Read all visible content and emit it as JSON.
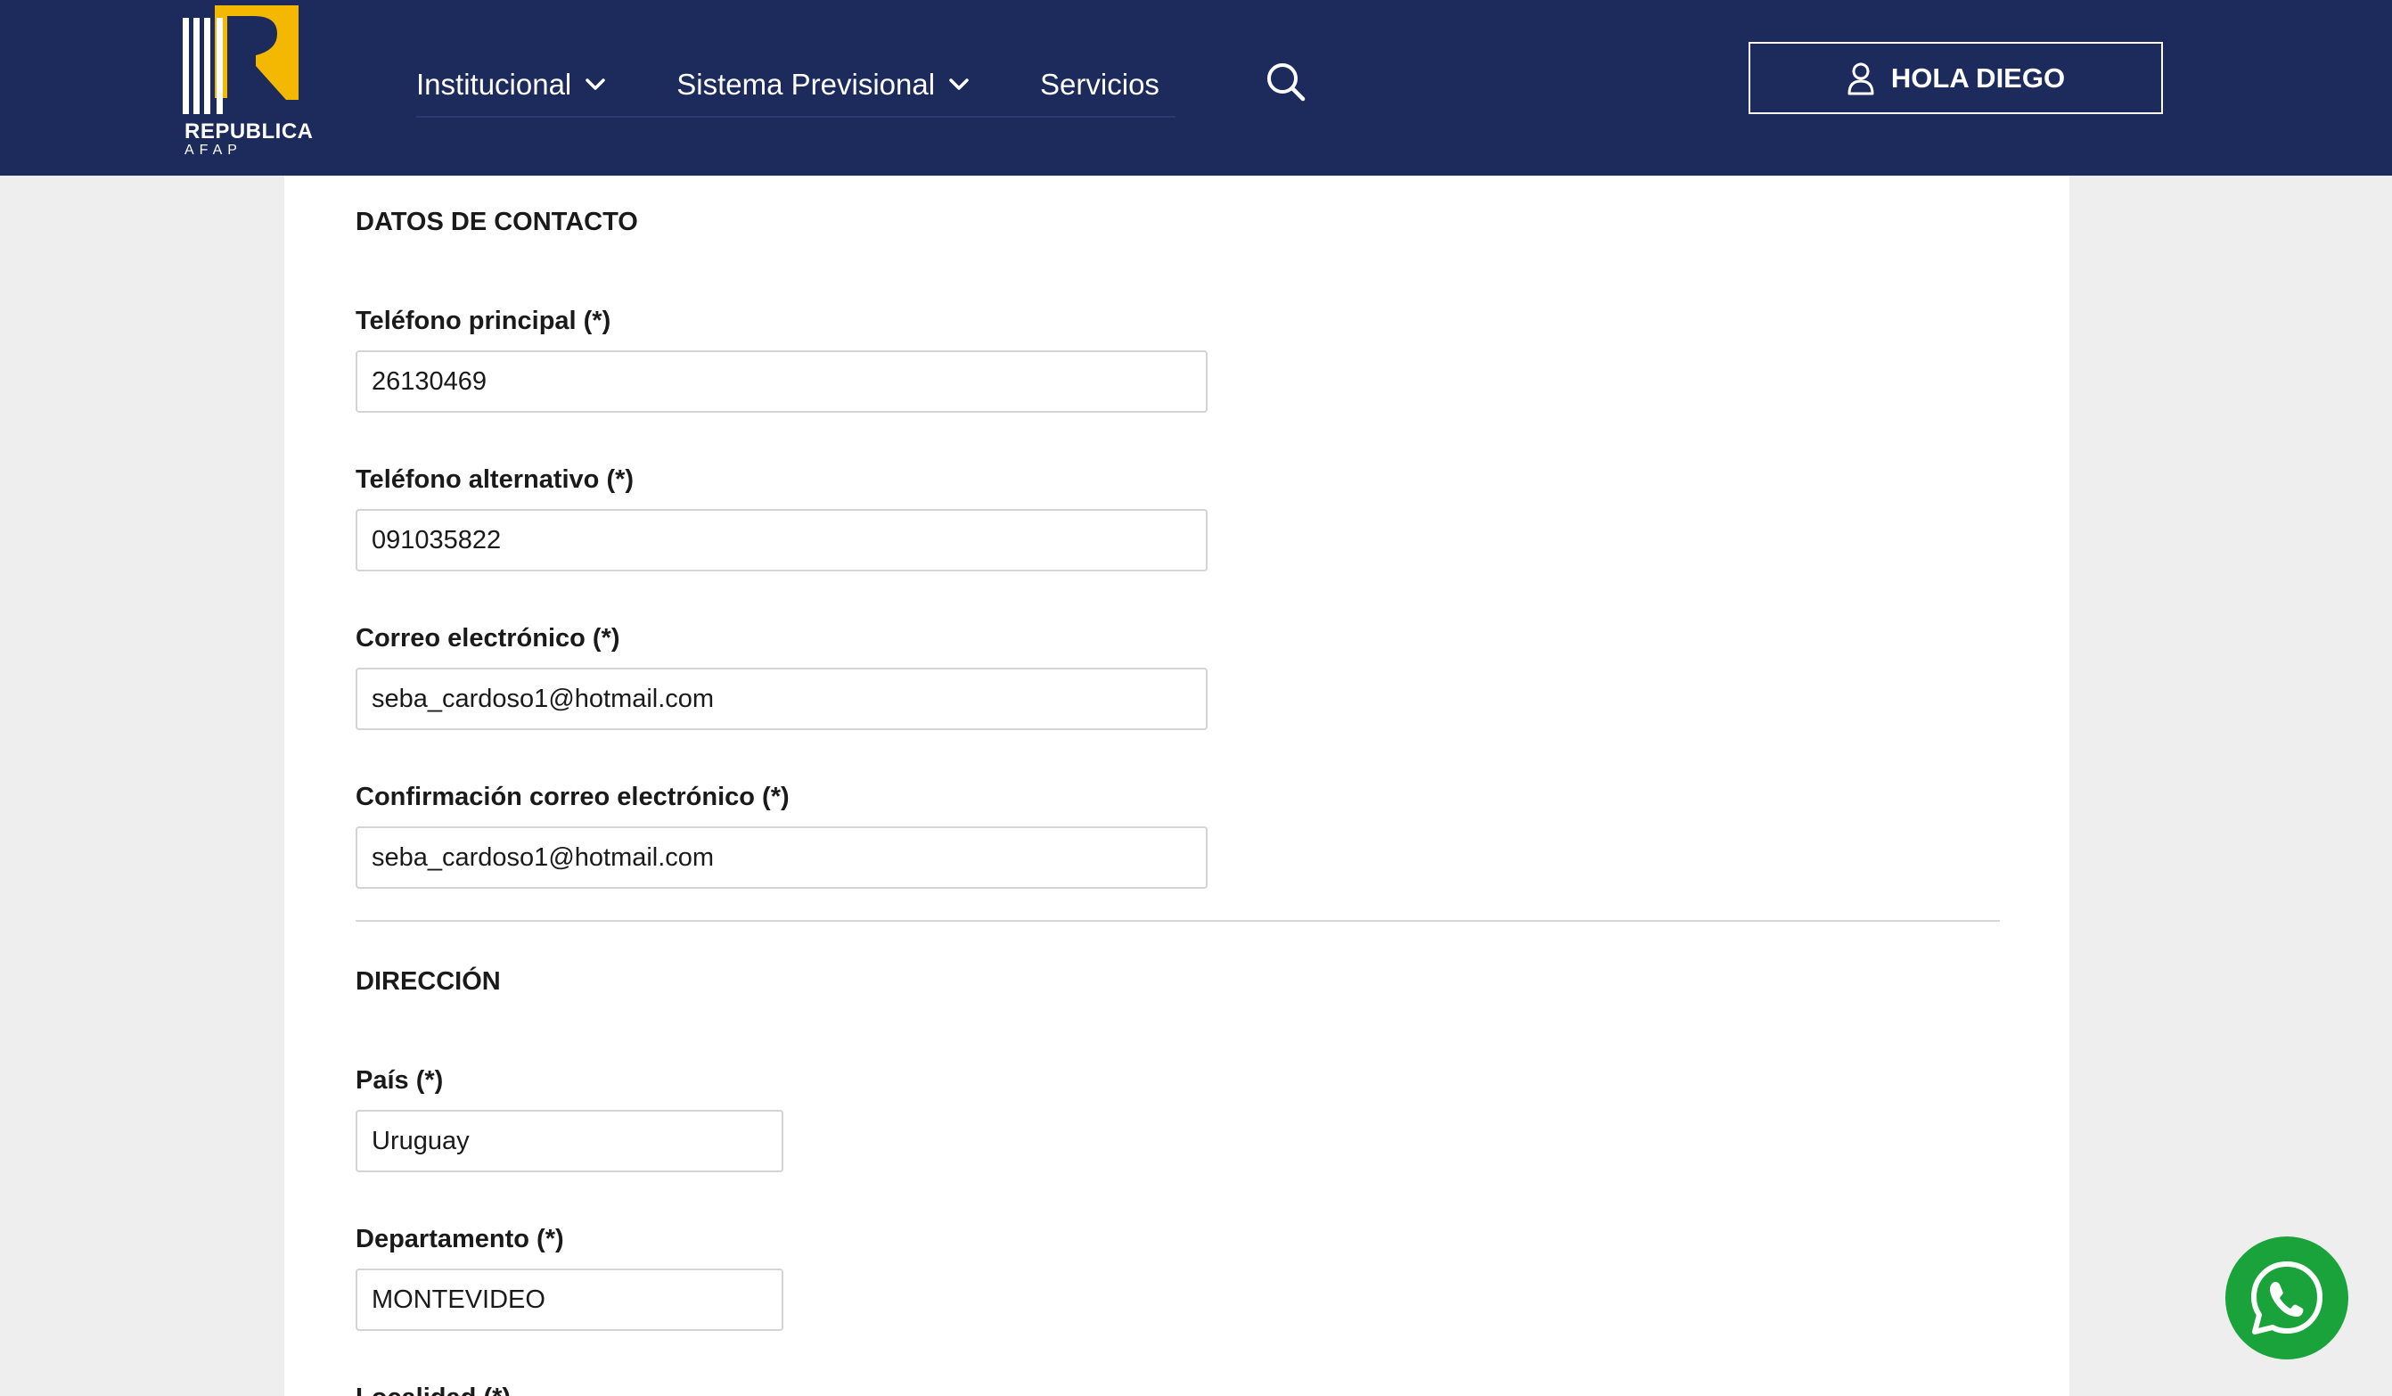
{
  "brand": {
    "name": "REPUBLICA",
    "sub": "AFAP",
    "colors": {
      "navy": "#1c2a5c",
      "gold": "#f5b800",
      "white": "#ffffff",
      "whatsapp": "#1aa33b"
    }
  },
  "nav": {
    "items": [
      {
        "label": "Institucional",
        "icon": "chevron-down-icon"
      },
      {
        "label": "Sistema Previsional",
        "icon": "chevron-down-icon"
      },
      {
        "label": "Servicios"
      }
    ],
    "search_icon": "search-icon"
  },
  "user": {
    "label": "HOLA DIEGO",
    "icon": "user-icon"
  },
  "contact": {
    "title": "DATOS DE CONTACTO",
    "phone_main": {
      "label": "Teléfono principal (*)",
      "value": "26130469"
    },
    "phone_alt": {
      "label": "Teléfono alternativo (*)",
      "value": "091035822"
    },
    "email": {
      "label": "Correo electrónico (*)",
      "value": "seba_cardoso1@hotmail.com"
    },
    "email_confirm": {
      "label": "Confirmación correo electrónico (*)",
      "value": "seba_cardoso1@hotmail.com"
    }
  },
  "address": {
    "title": "DIRECCIÓN",
    "country": {
      "label": "País (*)",
      "value": "Uruguay"
    },
    "department": {
      "label": "Departamento (*)",
      "value": "MONTEVIDEO"
    },
    "locality": {
      "label": "Localidad (*)"
    }
  },
  "whatsapp_icon": "whatsapp-icon"
}
